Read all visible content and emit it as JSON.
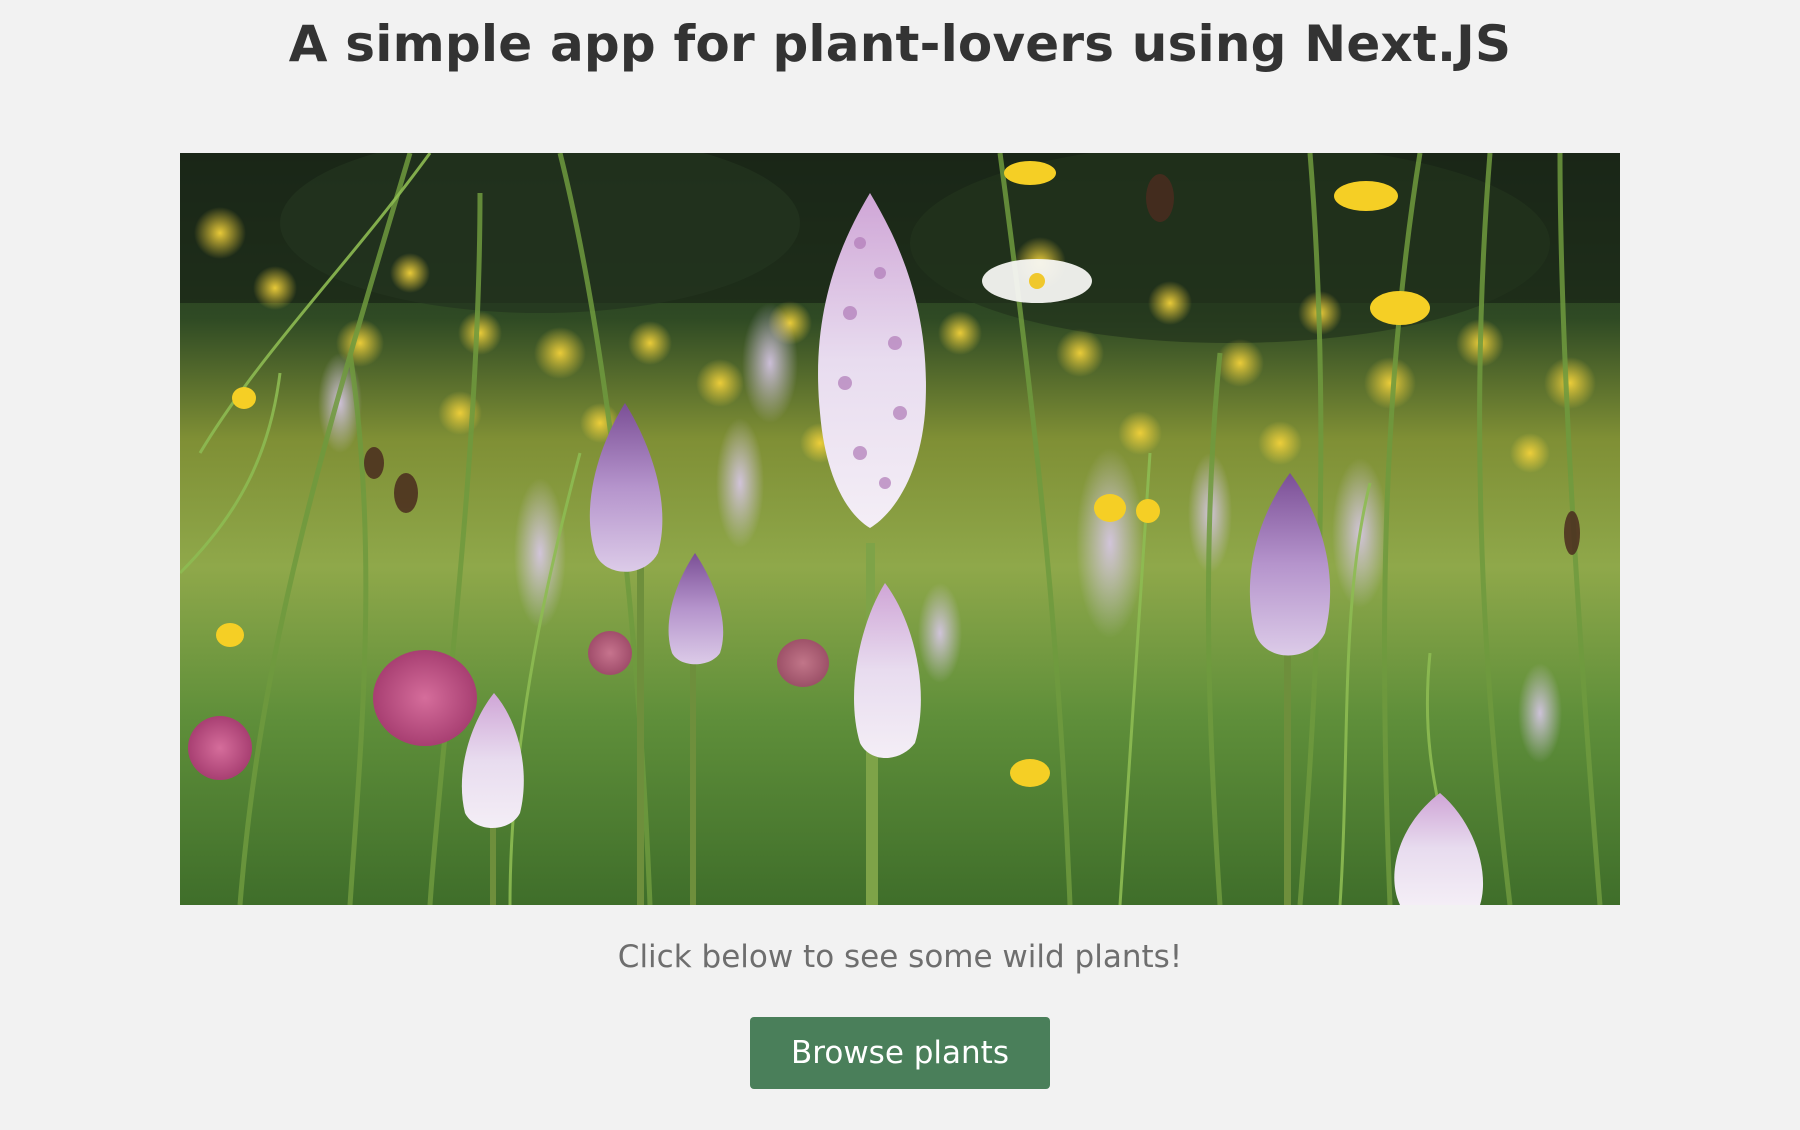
{
  "header": {
    "title": "A simple app for plant-lovers using Next.JS"
  },
  "hero": {
    "image_name": "wildflower-meadow-photo"
  },
  "main": {
    "tagline": "Click below to see some wild plants!",
    "browse_label": "Browse plants"
  },
  "colors": {
    "background": "#f2f2f2",
    "button": "#4a7f5a",
    "title_text": "#333333",
    "tagline_text": "#6e6e6e"
  }
}
